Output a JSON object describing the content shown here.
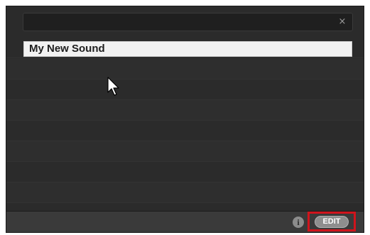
{
  "search": {
    "value": "",
    "placeholder": "",
    "clear_icon": "×"
  },
  "list": {
    "items": [
      {
        "label": "My New Sound",
        "selected": true
      }
    ]
  },
  "footer": {
    "info_icon": "i",
    "edit_label": "EDIT"
  },
  "colors": {
    "panel_bg": "#2b2b2b",
    "highlight": "#d0141c",
    "selected_bg": "#f2f2f2"
  }
}
